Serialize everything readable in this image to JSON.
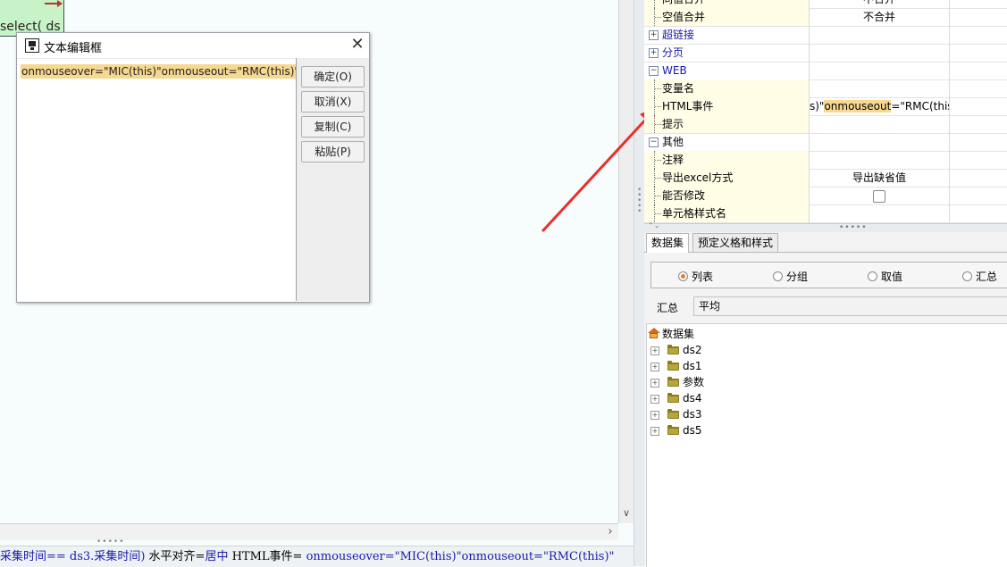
{
  "canvas": {
    "cell_text": "select( ds"
  },
  "status_bar": {
    "part1": "采集时间== ds3.采集时间) ",
    "part2": "水平对齐=",
    "part3": "居中",
    "part4": " HTML事件= ",
    "part5": "onmouseover=\"MIC(this)\"onmouseout=\"RMC(this)\""
  },
  "dialog": {
    "title": "文本编辑框",
    "text": "onmouseover=\"MIC(this)\"onmouseout=\"RMC(this)\"",
    "buttons": {
      "ok": "确定(O)",
      "cancel": "取消(X)",
      "copy": "复制(C)",
      "paste": "粘贴(P)"
    }
  },
  "properties": {
    "rows": [
      {
        "name": "同值合并",
        "value": "不合并"
      },
      {
        "name": "空值合并",
        "value": "不合并"
      },
      {
        "name": "超链接",
        "value": ""
      },
      {
        "name": "分页",
        "value": ""
      },
      {
        "name": "WEB",
        "value": ""
      },
      {
        "name": "变量名",
        "value": ""
      },
      {
        "name": "HTML事件",
        "value_pre": "s)\"",
        "value_hl": "onmouseout",
        "value_post": "=\"RMC(this)\""
      },
      {
        "name": "提示",
        "value": ""
      },
      {
        "name": "其他",
        "value": ""
      },
      {
        "name": "注释",
        "value": ""
      },
      {
        "name": "导出excel方式",
        "value": "导出缺省值"
      },
      {
        "name": "能否修改",
        "value": ""
      },
      {
        "name": "单元格样式名",
        "value": ""
      }
    ]
  },
  "tabs": [
    "数据集",
    "预定义格和样式"
  ],
  "radio_options": [
    "列表",
    "分组",
    "取值",
    "汇总"
  ],
  "summary": {
    "label": "汇总",
    "value": "平均"
  },
  "dataset_tree": {
    "root": "数据集",
    "items": [
      "ds2",
      "ds1",
      "参数",
      "ds4",
      "ds3",
      "ds5"
    ]
  },
  "colors": {
    "highlight": "#f7d891",
    "category_text": "#1a1aaa",
    "arrow": "#e8302a"
  }
}
